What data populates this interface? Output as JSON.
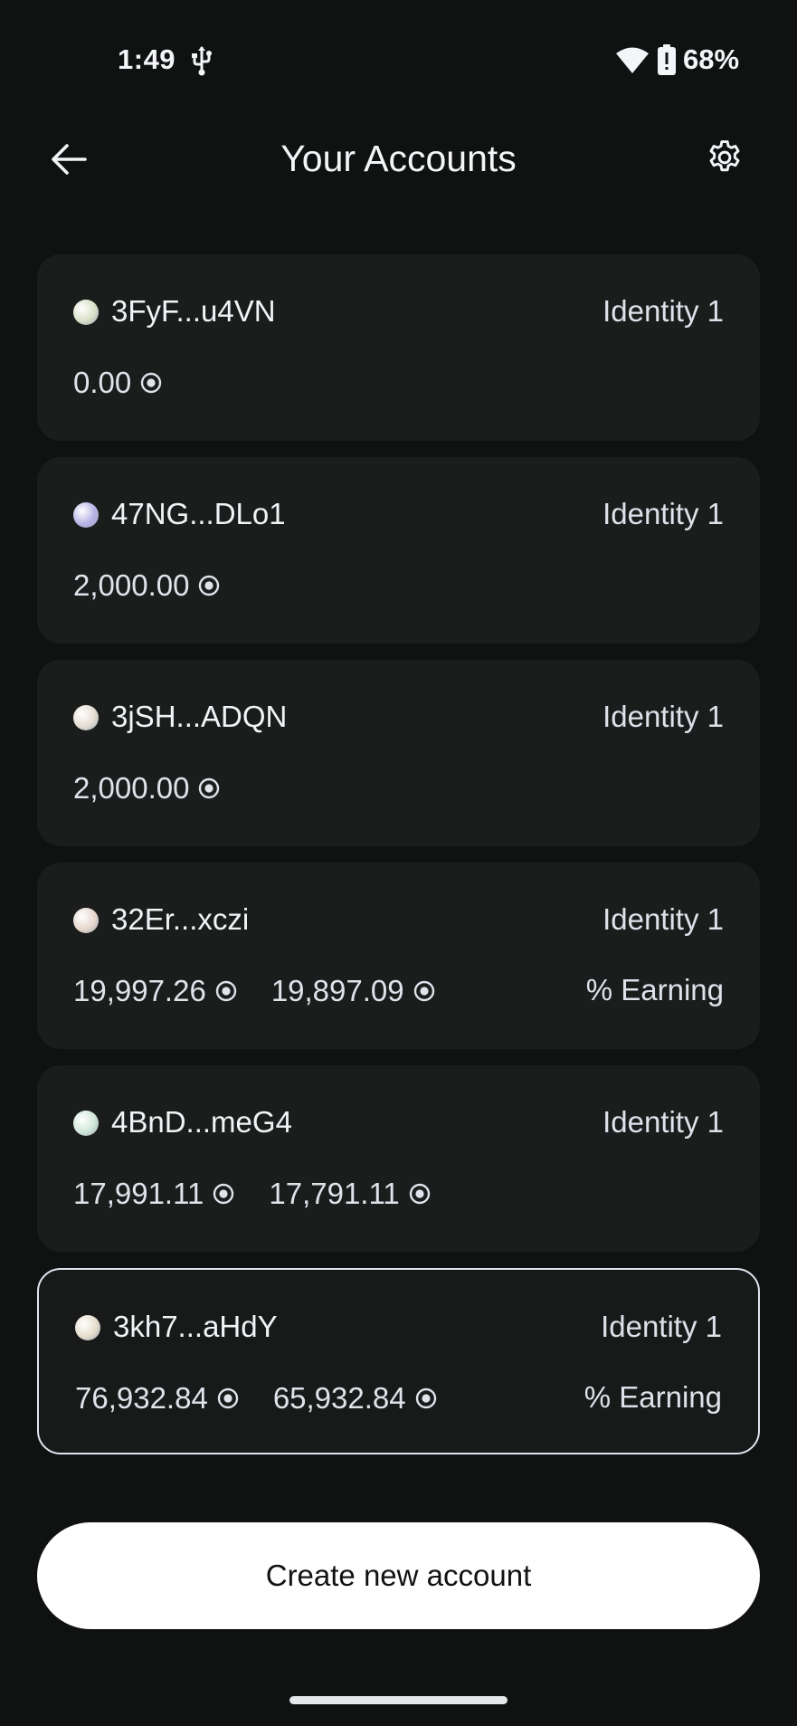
{
  "status_bar": {
    "time": "1:49",
    "battery": "68%"
  },
  "header": {
    "title": "Your Accounts"
  },
  "accounts": [
    {
      "address": "3FyF...u4VN",
      "identity": "Identity 1",
      "balances": [
        "0.00"
      ],
      "earning": "",
      "avatar_color": "#d9dfc8"
    },
    {
      "address": "47NG...DLo1",
      "identity": "Identity 1",
      "balances": [
        "2,000.00"
      ],
      "earning": "",
      "avatar_color": "#b7b2e6"
    },
    {
      "address": "3jSH...ADQN",
      "identity": "Identity 1",
      "balances": [
        "2,000.00"
      ],
      "earning": "",
      "avatar_color": "#e3ddd0"
    },
    {
      "address": "32Er...xczi",
      "identity": "Identity 1",
      "balances": [
        "19,997.26",
        "19,897.09"
      ],
      "earning": "% Earning",
      "avatar_color": "#e6d7cd"
    },
    {
      "address": "4BnD...meG4",
      "identity": "Identity 1",
      "balances": [
        "17,991.11",
        "17,791.11"
      ],
      "earning": "",
      "avatar_color": "#cfe7da"
    },
    {
      "address": "3kh7...aHdY",
      "identity": "Identity 1",
      "balances": [
        "76,932.84",
        "65,932.84"
      ],
      "earning": "% Earning",
      "avatar_color": "#e6dccb"
    }
  ],
  "selected_account_index": 5,
  "create_button": {
    "label": "Create new account"
  },
  "icons": {
    "back": "arrow-left-icon",
    "settings": "gear-icon",
    "token": "token-coin-icon",
    "usb": "usb-icon",
    "wifi": "wifi-icon",
    "battery": "battery-icon"
  }
}
